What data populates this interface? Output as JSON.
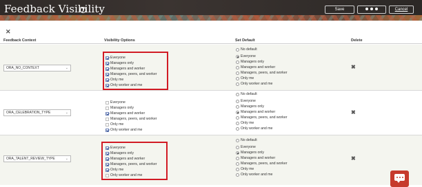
{
  "header": {
    "title": "Feedback Visibility",
    "help_icon": "help-circle-icon",
    "save_label": "Save",
    "more_icon": "more-dots-icon",
    "cancel_label": "Cancel"
  },
  "toolbar": {
    "close_icon": "close-icon"
  },
  "columns": {
    "context": "Feedback Context",
    "visibility": "Visibility Options",
    "default": "Set Default",
    "delete": "Delete"
  },
  "rows": [
    {
      "context": "ORA_NO_CONTEXT",
      "visibility": [
        {
          "label": "Everyone",
          "checked": true
        },
        {
          "label": "Managers only",
          "checked": true
        },
        {
          "label": "Managers and worker",
          "checked": true
        },
        {
          "label": "Managers, peers, and worker",
          "checked": true
        },
        {
          "label": "Only me",
          "checked": true
        },
        {
          "label": "Only worker and me",
          "checked": true
        }
      ],
      "defaults": [
        {
          "label": "No default",
          "selected": false
        },
        {
          "label": "Everyone",
          "selected": true
        },
        {
          "label": "Managers only",
          "selected": false
        },
        {
          "label": "Managers and worker",
          "selected": false
        },
        {
          "label": "Managers, peers, and worker",
          "selected": false
        },
        {
          "label": "Only me",
          "selected": false
        },
        {
          "label": "Only worker and me",
          "selected": false
        }
      ]
    },
    {
      "context": "ORA_CELEBRATION_TYPE",
      "visibility": [
        {
          "label": "Everyone",
          "checked": false
        },
        {
          "label": "Managers only",
          "checked": false
        },
        {
          "label": "Managers and worker",
          "checked": true
        },
        {
          "label": "Managers, peers, and worker",
          "checked": false
        },
        {
          "label": "Only me",
          "checked": false
        },
        {
          "label": "Only worker and me",
          "checked": true
        }
      ],
      "defaults": [
        {
          "label": "No default",
          "selected": false
        },
        {
          "label": "Everyone",
          "selected": false
        },
        {
          "label": "Managers only",
          "selected": false
        },
        {
          "label": "Managers and worker",
          "selected": true
        },
        {
          "label": "Managers, peers, and worker",
          "selected": false
        },
        {
          "label": "Only me",
          "selected": false
        },
        {
          "label": "Only worker and me",
          "selected": false
        }
      ]
    },
    {
      "context": "ORA_TALENT_REVIEW_TYPE",
      "visibility": [
        {
          "label": "Everyone",
          "checked": true
        },
        {
          "label": "Managers only",
          "checked": true
        },
        {
          "label": "Managers and worker",
          "checked": true
        },
        {
          "label": "Managers, peers, and worker",
          "checked": true
        },
        {
          "label": "Only me",
          "checked": true
        },
        {
          "label": "Only worker and me",
          "checked": false
        }
      ],
      "defaults": [
        {
          "label": "No default",
          "selected": false
        },
        {
          "label": "Everyone",
          "selected": false
        },
        {
          "label": "Managers only",
          "selected": true
        },
        {
          "label": "Managers and worker",
          "selected": false
        },
        {
          "label": "Managers, peers, and worker",
          "selected": false
        },
        {
          "label": "Only me",
          "selected": false
        },
        {
          "label": "Only worker and me",
          "selected": false
        }
      ]
    }
  ],
  "delete_icon": "delete-x-icon",
  "chat_icon": "chat-bubble-icon",
  "colors": {
    "header_bg": "#2f2a28",
    "highlight_box": "#d11a24",
    "chat_button": "#c63a2d",
    "checkbox_check": "#2f4e96"
  }
}
